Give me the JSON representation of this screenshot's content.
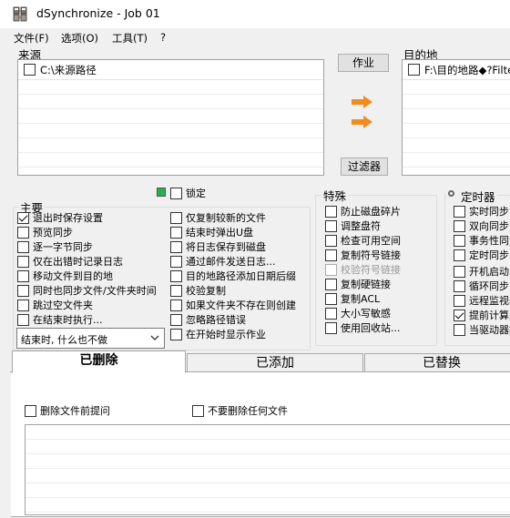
{
  "window": {
    "title": "dSynchronize - Job 01"
  },
  "menu": [
    "文件(F)",
    "选项(O)",
    "工具(T)",
    "?"
  ],
  "source": {
    "label": "来源",
    "paths": [
      {
        "checked": false,
        "path": "C:\\来源路径"
      }
    ]
  },
  "destination": {
    "label": "目的地",
    "paths": [
      {
        "checked": false,
        "path": "F:\\目的地路◆?Filte"
      }
    ]
  },
  "buttons": {
    "job": "作业",
    "filter": "过滤器"
  },
  "lock": {
    "label": "锁定",
    "checked": false,
    "indicator_color": "#22b14c"
  },
  "main": {
    "label": "主要",
    "col1": [
      {
        "label": "退出时保存设置",
        "checked": true
      },
      {
        "label": "预览同步",
        "checked": false
      },
      {
        "label": "逐一字节同步",
        "checked": false
      },
      {
        "label": "仅在出错时记录日志",
        "checked": false
      },
      {
        "label": "移动文件到目的地",
        "checked": false
      },
      {
        "label": "同时也同步文件/文件夹时间",
        "checked": false
      },
      {
        "label": "跳过空文件夹",
        "checked": false
      },
      {
        "label": "在结束时执行...",
        "checked": false
      }
    ],
    "col2": [
      {
        "label": "仅复制较新的文件",
        "checked": false
      },
      {
        "label": "结束时弹出U盘",
        "checked": false
      },
      {
        "label": "将日志保存到磁盘",
        "checked": false
      },
      {
        "label": "通过邮件发送日志...",
        "checked": false
      },
      {
        "label": "目的地路径添加日期后缀",
        "checked": false
      },
      {
        "label": "校验复制",
        "checked": false
      },
      {
        "label": "如果文件夹不存在则创建",
        "checked": false
      },
      {
        "label": "忽略路径错误",
        "checked": false
      },
      {
        "label": "在开始时显示作业",
        "checked": false
      }
    ],
    "on_finish": "结束时, 什么也不做"
  },
  "special": {
    "label": "特殊",
    "items": [
      {
        "label": "防止磁盘碎片",
        "checked": false,
        "disabled": false
      },
      {
        "label": "调整盘符",
        "checked": false,
        "disabled": false
      },
      {
        "label": "检查可用空间",
        "checked": false,
        "disabled": false
      },
      {
        "label": "复制符号链接",
        "checked": false,
        "disabled": false
      },
      {
        "label": "校验符号链接",
        "checked": false,
        "disabled": true
      },
      {
        "label": "复制硬链接",
        "checked": false,
        "disabled": false
      },
      {
        "label": "复制ACL",
        "checked": false,
        "disabled": false
      },
      {
        "label": "大小写敏感",
        "checked": false,
        "disabled": false
      },
      {
        "label": "使用回收站...",
        "checked": false,
        "disabled": false
      }
    ]
  },
  "timer": {
    "label": "定时器",
    "items": [
      {
        "label": "实时同步...",
        "checked": false
      },
      {
        "label": "双向同步",
        "checked": false
      },
      {
        "label": "事务性同步",
        "checked": false
      },
      {
        "label": "定时同步...",
        "checked": false
      },
      {
        "label": "开机启动",
        "checked": false
      },
      {
        "label": "循环同步",
        "checked": false
      },
      {
        "label": "远程监视器",
        "checked": false
      },
      {
        "label": "提前计算差",
        "checked": true
      },
      {
        "label": "当驱动器接",
        "checked": false
      }
    ]
  },
  "tabs": [
    {
      "label": "已删除",
      "active": true
    },
    {
      "label": "已添加",
      "active": false
    },
    {
      "label": "已替换",
      "active": false
    }
  ],
  "deleted_panel": {
    "ask_before_delete": {
      "label": "删除文件前提问",
      "checked": false
    },
    "never_delete": {
      "label": "不要删除任何文件",
      "checked": false
    }
  }
}
